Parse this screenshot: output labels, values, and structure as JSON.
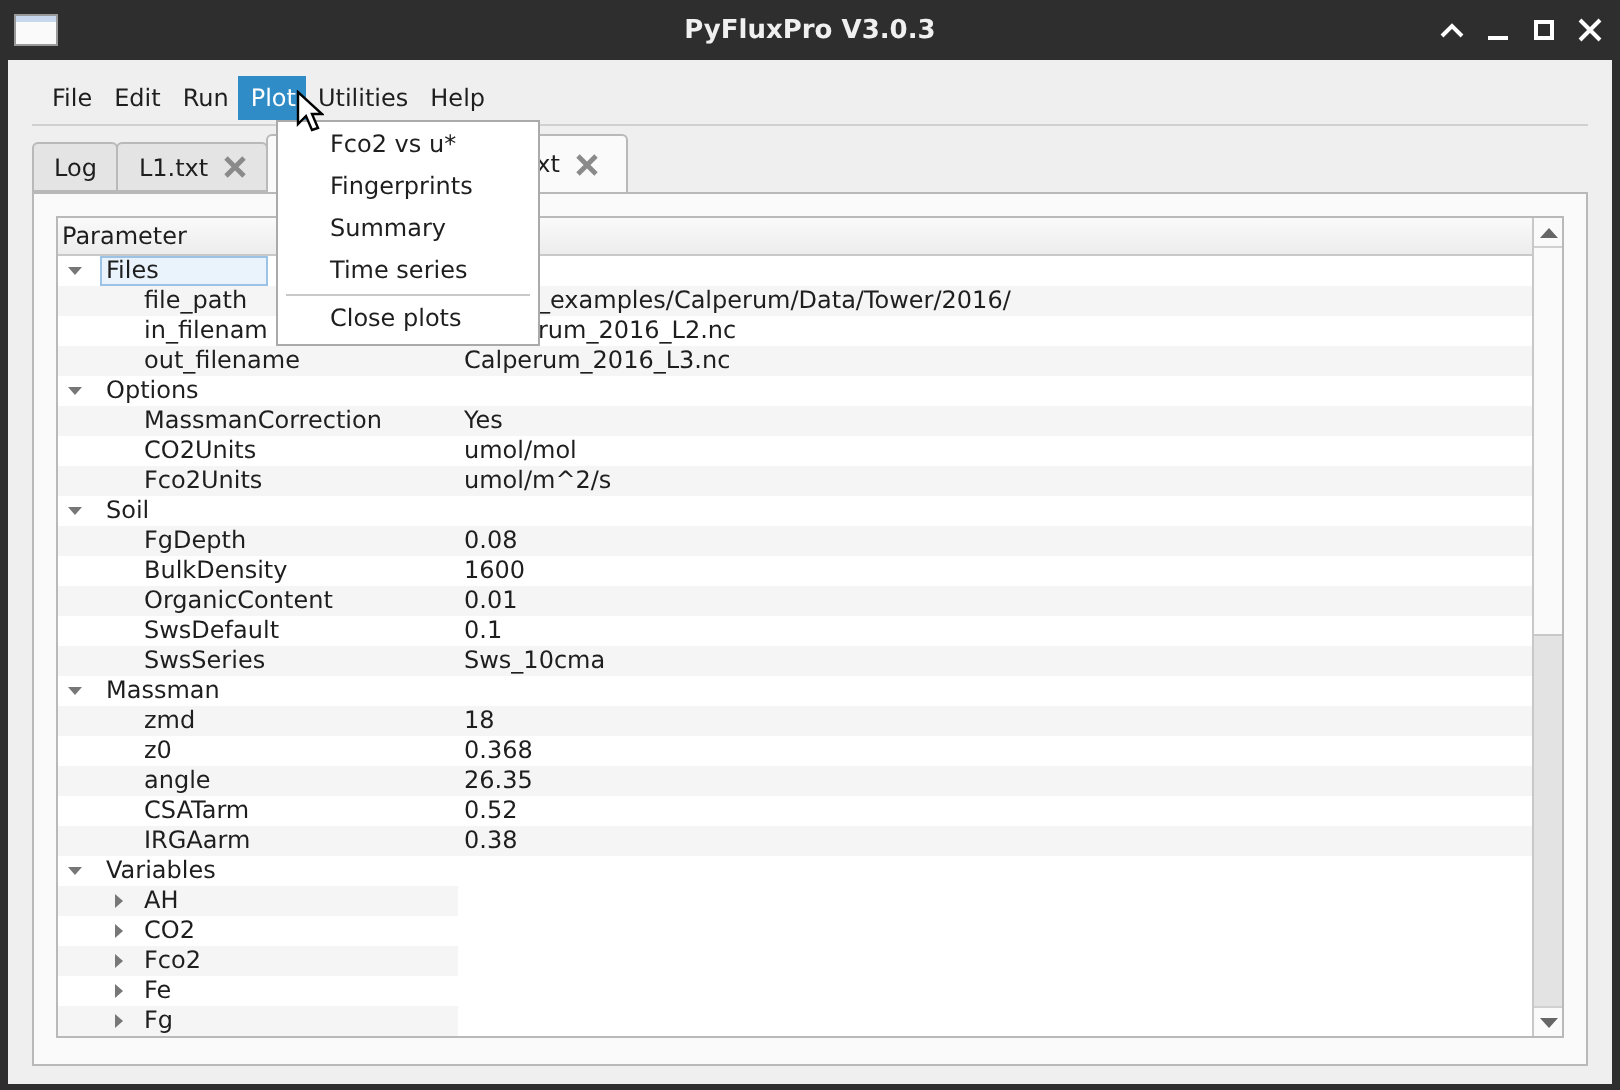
{
  "window": {
    "title": "PyFluxPro V3.0.3"
  },
  "menubar": [
    {
      "label": "File",
      "selected": false
    },
    {
      "label": "Edit",
      "selected": false
    },
    {
      "label": "Run",
      "selected": false
    },
    {
      "label": "Plot",
      "selected": true
    },
    {
      "label": "Utilities",
      "selected": false
    },
    {
      "label": "Help",
      "selected": false
    }
  ],
  "open_menu": {
    "items": [
      {
        "kind": "item",
        "label": "Fco2 vs u*"
      },
      {
        "kind": "item",
        "label": "Fingerprints"
      },
      {
        "kind": "item",
        "label": "Summary"
      },
      {
        "kind": "item",
        "label": "Time series"
      },
      {
        "kind": "separator"
      },
      {
        "kind": "item",
        "label": "Close plots"
      }
    ]
  },
  "tabs": [
    {
      "label": "Log",
      "selected": false,
      "closable": false,
      "covered": false
    },
    {
      "label": "L1.txt",
      "selected": false,
      "closable": true,
      "covered": false
    },
    {
      "label": "xt",
      "selected": true,
      "closable": true,
      "covered": true
    }
  ],
  "tree": {
    "header": "Parameter",
    "groups": [
      {
        "label": "Files",
        "expanded": true,
        "selected": true,
        "children": [
          {
            "label": "file_path",
            "value": "_examples/Calperum/Data/Tower/2016/",
            "covered": true
          },
          {
            "label": "in_filenam",
            "value": "rum_2016_L2.nc",
            "covered": true
          },
          {
            "label": "out_filename",
            "value": "Calperum_2016_L3.nc",
            "covered": false
          }
        ]
      },
      {
        "label": "Options",
        "expanded": true,
        "selected": false,
        "children": [
          {
            "label": "MassmanCorrection",
            "value": "Yes",
            "covered": false
          },
          {
            "label": "CO2Units",
            "value": "umol/mol",
            "covered": false
          },
          {
            "label": "Fco2Units",
            "value": "umol/m^2/s",
            "covered": false
          }
        ]
      },
      {
        "label": "Soil",
        "expanded": true,
        "selected": false,
        "children": [
          {
            "label": "FgDepth",
            "value": "0.08",
            "covered": false
          },
          {
            "label": "BulkDensity",
            "value": "1600",
            "covered": false
          },
          {
            "label": "OrganicContent",
            "value": "0.01",
            "covered": false
          },
          {
            "label": "SwsDefault",
            "value": "0.1",
            "covered": false
          },
          {
            "label": "SwsSeries",
            "value": "Sws_10cma",
            "covered": false
          }
        ]
      },
      {
        "label": "Massman",
        "expanded": true,
        "selected": false,
        "children": [
          {
            "label": "zmd",
            "value": "18",
            "covered": false
          },
          {
            "label": "z0",
            "value": "0.368",
            "covered": false
          },
          {
            "label": "angle",
            "value": "26.35",
            "covered": false
          },
          {
            "label": "CSATarm",
            "value": "0.52",
            "covered": false
          },
          {
            "label": "IRGAarm",
            "value": "0.38",
            "covered": false
          }
        ]
      },
      {
        "label": "Variables",
        "expanded": true,
        "selected": false,
        "children": [
          {
            "label": "AH",
            "expanded": false
          },
          {
            "label": "CO2",
            "expanded": false
          },
          {
            "label": "Fco2",
            "expanded": false
          },
          {
            "label": "Fe",
            "expanded": false
          },
          {
            "label": "Fg",
            "expanded": false
          }
        ]
      }
    ]
  }
}
